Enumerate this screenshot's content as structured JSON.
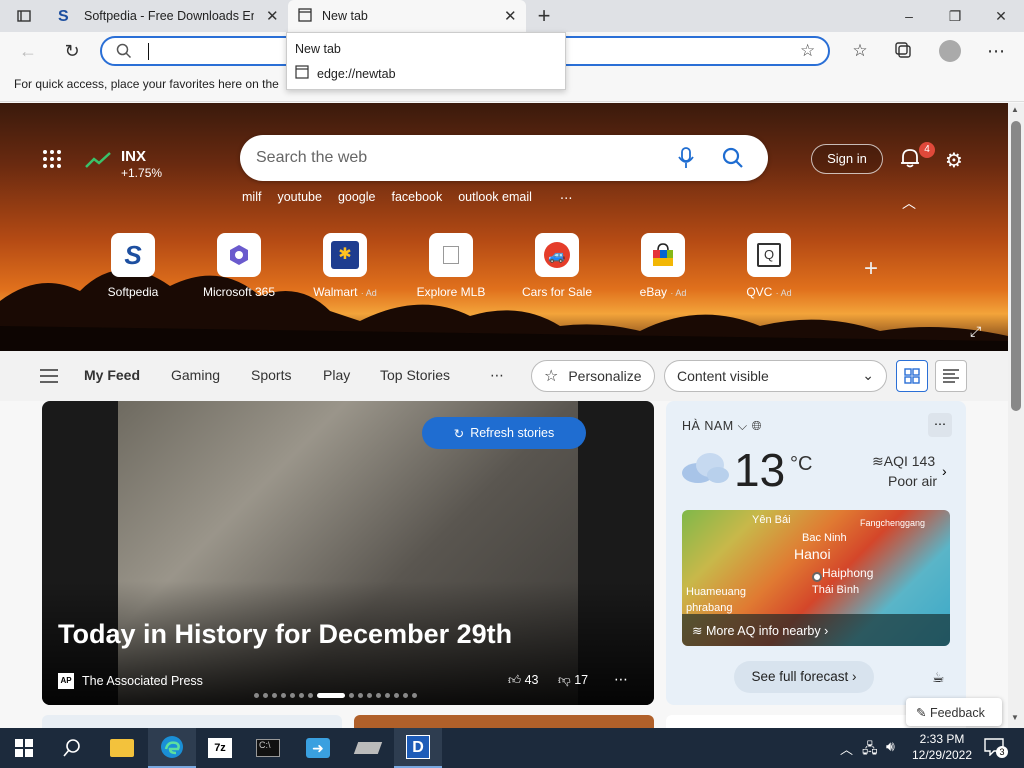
{
  "tabs": [
    {
      "title": "Softpedia - Free Downloads Encyclopedia",
      "icon": "softpedia-icon",
      "active": false
    },
    {
      "title": "New tab",
      "icon": "newtab-icon",
      "active": true
    }
  ],
  "window_controls": {
    "minimize": "–",
    "maximize": "❐",
    "close": "✕"
  },
  "address": {
    "value": "",
    "placeholder": ""
  },
  "favorites_hint": "For quick access, place your favorites here on the",
  "dropdown": {
    "title": "New tab",
    "item": "edge://newtab"
  },
  "hero": {
    "stock": {
      "symbol": "INX",
      "change": "+1.75%"
    },
    "search_placeholder": "Search the web",
    "suggestions": [
      "milf",
      "youtube",
      "google",
      "facebook",
      "outlook email"
    ],
    "sign_in": "Sign in",
    "notification_count": "4",
    "quicklinks": [
      {
        "label": "Softpedia",
        "ad": ""
      },
      {
        "label": "Microsoft 365",
        "ad": ""
      },
      {
        "label": "Walmart",
        "ad": "· Ad"
      },
      {
        "label": "Explore MLB",
        "ad": ""
      },
      {
        "label": "Cars for Sale",
        "ad": ""
      },
      {
        "label": "eBay",
        "ad": "· Ad"
      },
      {
        "label": "QVC",
        "ad": "· Ad"
      }
    ]
  },
  "feed_nav": {
    "items": [
      "My Feed",
      "Gaming",
      "Sports",
      "Play",
      "Top Stories"
    ],
    "personalize": "Personalize",
    "content_select": "Content visible"
  },
  "news": {
    "refresh": "Refresh stories",
    "headline": "Today in History for December 29th",
    "source": "The Associated Press",
    "source_logo": "AP",
    "likes": "43",
    "dislikes": "17"
  },
  "weather": {
    "location": "HÀ NAM",
    "temp": "13",
    "unit": "°C",
    "aqi": "AQI 143",
    "aqi_status": "Poor air",
    "map_labels": [
      "Yên Bái",
      "Bac Ninh",
      "Fangchenggang",
      "Hanoi",
      "Haiphong",
      "Thái Bình",
      "Huameuang",
      "phrabang"
    ],
    "map_link": "More AQ info nearby",
    "forecast": "See full forecast"
  },
  "feedback": "Feedback",
  "clock": {
    "time": "2:33 PM",
    "date": "12/29/2022"
  },
  "notification_badge": "3"
}
